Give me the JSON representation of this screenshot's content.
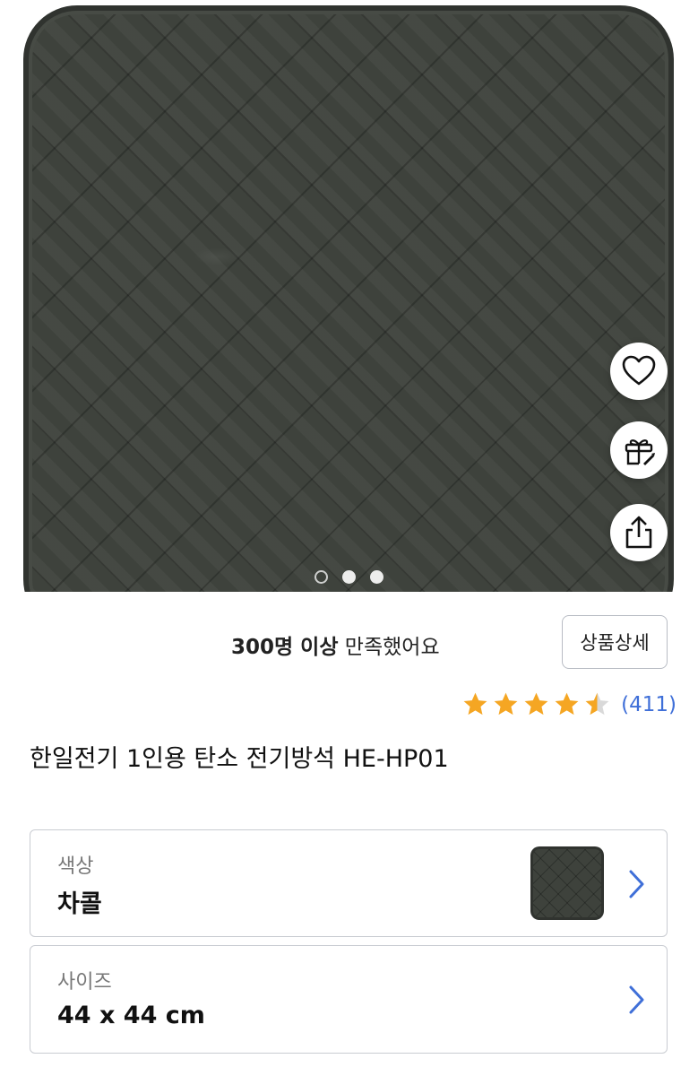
{
  "gallery": {
    "image_description": "Charcoal quilted electric seat mat",
    "dots": [
      {
        "active": false
      },
      {
        "active": true
      },
      {
        "active": true
      }
    ]
  },
  "actions": {
    "wishlist_icon": "heart-icon",
    "gift_icon": "gift-icon",
    "share_icon": "share-icon"
  },
  "satisfaction": {
    "count_text": "300명 이상",
    "suffix_text": " 만족했어요"
  },
  "detail_button": {
    "label": "상품상세"
  },
  "rating": {
    "stars": 4.5,
    "review_count": "(411)",
    "star_color": "#f5a623"
  },
  "product": {
    "title": "한일전기 1인용 탄소 전기방석 HE-HP01"
  },
  "options": {
    "color": {
      "label": "색상",
      "value": "차콜"
    },
    "size": {
      "label": "사이즈",
      "value": "44 x 44 cm"
    }
  },
  "colors": {
    "link": "#3f6fd8",
    "chevron": "#3f6fd8"
  }
}
